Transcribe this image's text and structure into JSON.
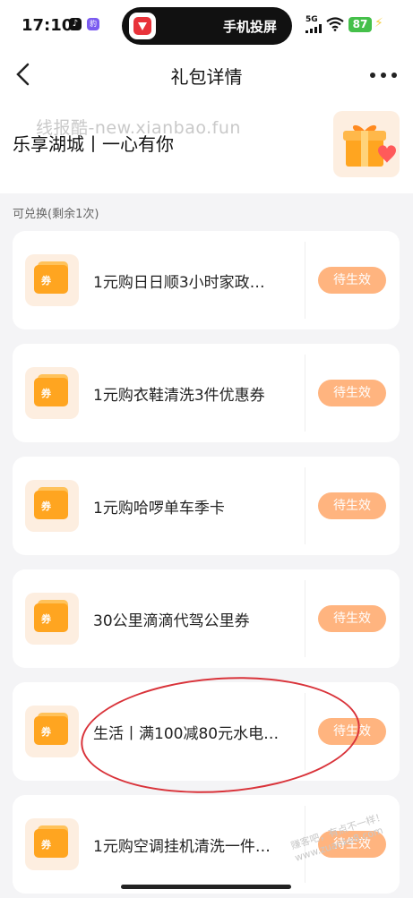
{
  "status_bar": {
    "time": "17:10",
    "tiktok_glyph": "♪",
    "app_badge": "豹",
    "cast_label": "手机投屏",
    "signal": "5G",
    "battery": "87"
  },
  "header": {
    "title": "礼包详情"
  },
  "gift": {
    "name": "乐享湖城丨一心有你",
    "watermark": "线报酷-new.xianbao.fun"
  },
  "section": {
    "label": "可兑换(剩余1次)"
  },
  "coupons": [
    {
      "icon_label": "券",
      "title": "1元购日日顺3小时家政…",
      "status": "待生效"
    },
    {
      "icon_label": "券",
      "title": "1元购衣鞋清洗3件优惠券",
      "status": "待生效"
    },
    {
      "icon_label": "券",
      "title": "1元购哈啰单车季卡",
      "status": "待生效"
    },
    {
      "icon_label": "券",
      "title": "30公里滴滴代驾公里券",
      "status": "待生效"
    },
    {
      "icon_label": "券",
      "title": "生活丨满100减80元水电…",
      "status": "待生效"
    },
    {
      "icon_label": "券",
      "title": "1元购空调挂机清洗一件…",
      "status": "待生效"
    }
  ],
  "stamp_text": "赚客吧，有点不一样！ www.zuanke8.com",
  "colors": {
    "accent_status": "#ffb47f",
    "coupon_orange": "#ffa520",
    "annotation_red": "#d9333a"
  }
}
